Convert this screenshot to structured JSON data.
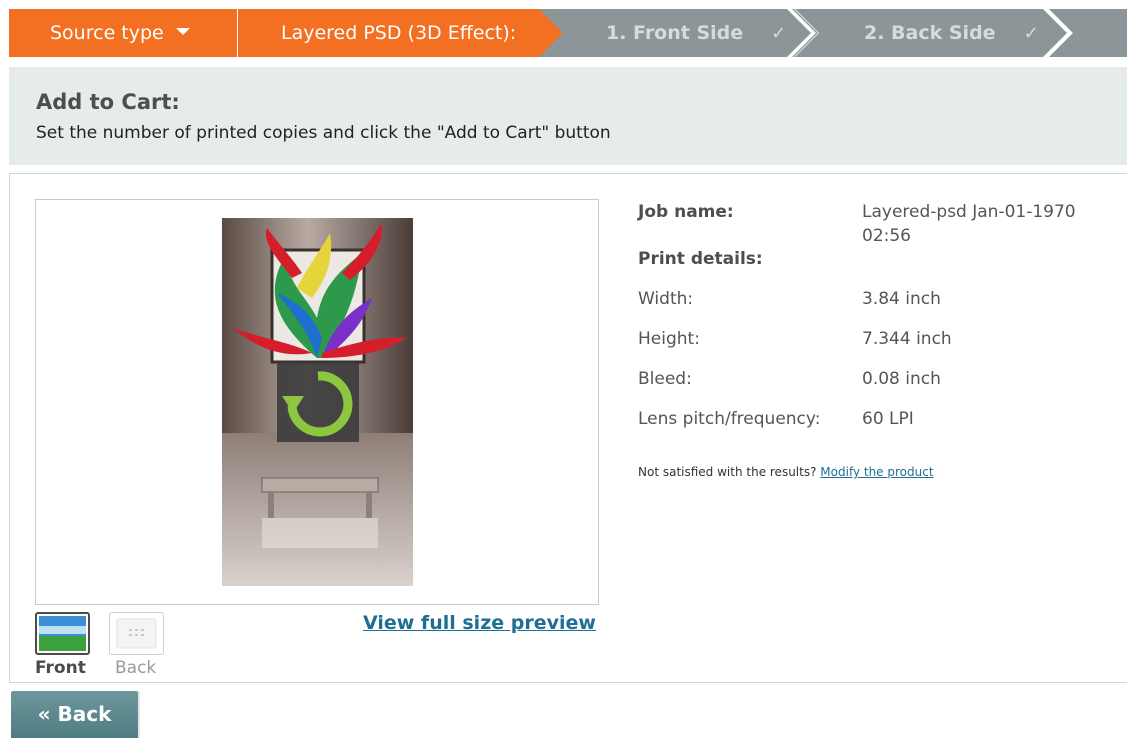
{
  "steps": {
    "source_type": "Source type",
    "layered": "Layered PSD (3D Effect):",
    "front": "1. Front Side",
    "back": "2. Back Side",
    "check_glyph": "✓"
  },
  "header": {
    "title": "Add to Cart:",
    "description": "Set the number of printed copies and click the \"Add to Cart\" button"
  },
  "preview": {
    "view_full_label": "View full size preview",
    "thumbs": {
      "front_label": "Front",
      "back_label": "Back"
    }
  },
  "details": {
    "job_name_label": "Job name:",
    "job_name_value_line1": "Layered-psd Jan-01-1970",
    "job_name_value_line2": "02:56",
    "print_details_label": "Print details:",
    "width_label": "Width:",
    "width_value": "3.84 inch",
    "height_label": "Height:",
    "height_value": "7.344 inch",
    "bleed_label": "Bleed:",
    "bleed_value": "0.08 inch",
    "lens_label": "Lens pitch/frequency:",
    "lens_value": "60 LPI",
    "note_text": "Not satisfied with the results?",
    "modify_link": "Modify the product"
  },
  "footer": {
    "back_label": "« Back"
  },
  "colors": {
    "accent": "#f36f21",
    "inactive_step": "#8c9698",
    "link": "#1f6f95",
    "header_bg": "#e5ecea",
    "button": "#5c878c"
  },
  "icons": [
    "caret-down-icon",
    "check-icon",
    "refresh-icon",
    "landscape-icon",
    "grid-icon"
  ]
}
